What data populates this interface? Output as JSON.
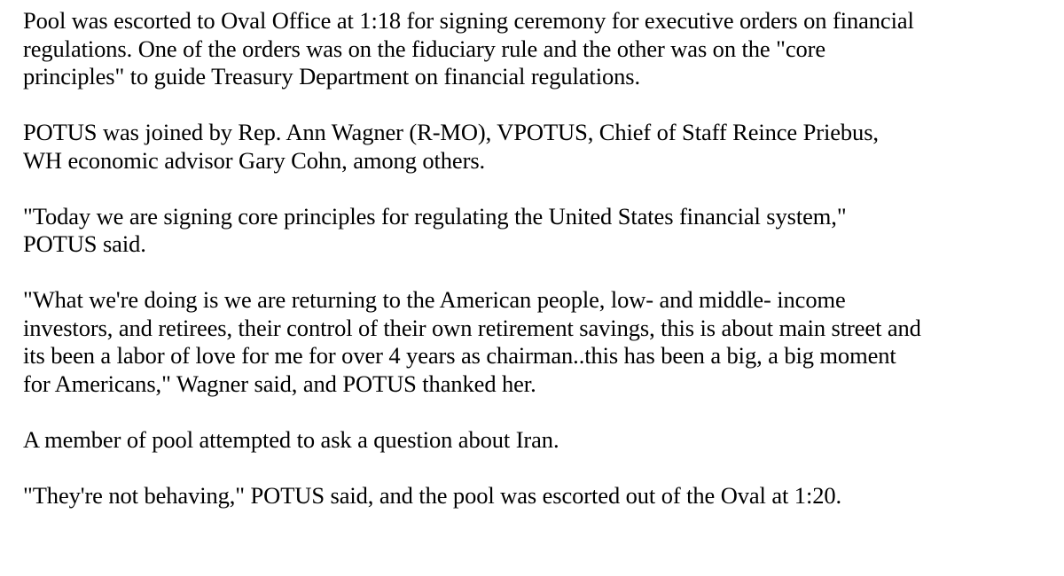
{
  "document": {
    "paragraphs": [
      {
        "lines": [
          "Pool was escorted to Oval Office at 1:18 for signing ceremony for executive orders on financial",
          "regulations. One of the orders was on the fiduciary rule and the other was on the \"core",
          "principles\" to guide Treasury Department on financial regulations."
        ]
      },
      {
        "lines": [
          "POTUS was joined by Rep. Ann Wagner (R-MO),  VPOTUS, Chief of Staff Reince Priebus,",
          "WH economic advisor Gary Cohn, among others."
        ]
      },
      {
        "lines": [
          "\"Today we are signing core principles for regulating the United States financial system,\"",
          "POTUS said."
        ]
      },
      {
        "lines": [
          "\"What we're doing is we are returning to the American people, low- and middle- income",
          "investors, and retirees, their control of their own retirement savings, this is about main street and",
          "its been a labor of love for me for over 4 years as chairman..this has been a big, a big moment",
          "for Americans,\" Wagner said, and POTUS thanked her."
        ]
      },
      {
        "lines": [
          "A member of pool attempted to ask a question about Iran."
        ]
      },
      {
        "lines": [
          "\"They're not behaving,\" POTUS said, and the pool was escorted out of the Oval at 1:20."
        ]
      }
    ]
  }
}
